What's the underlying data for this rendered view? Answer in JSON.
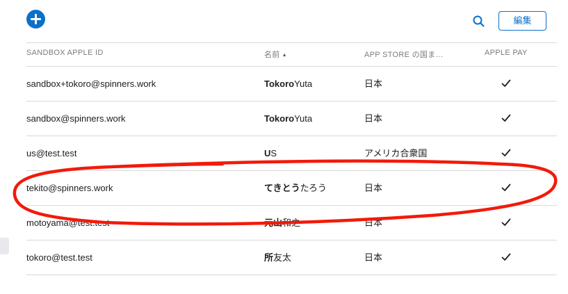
{
  "toolbar": {
    "edit_label": "編集"
  },
  "table": {
    "headers": {
      "apple_id": "SANDBOX APPLE ID",
      "name": "名前",
      "store": "APP STORE の国ま…",
      "apple_pay": "APPLE PAY"
    },
    "rows": [
      {
        "apple_id": "sandbox+tokoro@spinners.work",
        "last": "Tokoro",
        "first": "Yuta",
        "store": "日本",
        "apple_pay": true
      },
      {
        "apple_id": "sandbox@spinners.work",
        "last": "Tokoro",
        "first": "Yuta",
        "store": "日本",
        "apple_pay": true
      },
      {
        "apple_id": "us@test.test",
        "last": "U",
        "first": "S",
        "store": "アメリカ合衆国",
        "apple_pay": true
      },
      {
        "apple_id": "tekito@spinners.work",
        "last": "てきとう",
        "first": "たろう",
        "store": "日本",
        "apple_pay": true
      },
      {
        "apple_id": "motoyama@test.test",
        "last": "元山",
        "first": "和之",
        "store": "日本",
        "apple_pay": true
      },
      {
        "apple_id": "tokoro@test.test",
        "last": "所",
        "first": "友太",
        "store": "日本",
        "apple_pay": true
      }
    ]
  },
  "icons": {
    "add": "plus-circle-icon",
    "search": "magnifier-icon",
    "sort": "sort-ascending-icon",
    "apple_pay_enabled": "checkmark-icon"
  },
  "colors": {
    "accent": "#0a70c9",
    "annotation": "#f21a0a",
    "divider": "#d8d8dc",
    "header_text": "#7a7a7e"
  }
}
